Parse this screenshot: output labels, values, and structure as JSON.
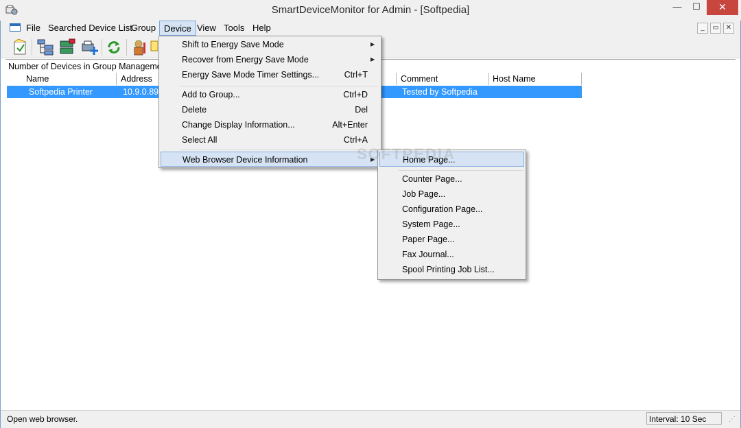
{
  "window": {
    "title": "SmartDeviceMonitor for Admin - [Softpedia]"
  },
  "title_buttons": {
    "minimize": "—",
    "maximize": "☐",
    "close": "✕"
  },
  "menubar": {
    "items": [
      "File",
      "Searched Device List",
      "Group",
      "Device",
      "View",
      "Tools",
      "Help"
    ],
    "mdi_buttons": [
      "_",
      "▭",
      "✕"
    ]
  },
  "group_bar": {
    "label": "Number of Devices in Group Managemer"
  },
  "list": {
    "columns": [
      "Name",
      "Address",
      "Comment",
      "Host Name"
    ],
    "rows": [
      {
        "name": "Softpedia Printer",
        "address": "10.9.0.89",
        "comment": "Tested by Softpedia",
        "host_name": ""
      }
    ]
  },
  "device_menu": {
    "items": [
      {
        "label": "Shift to Energy Save Mode",
        "shortcut": "",
        "submenu": true
      },
      {
        "label": "Recover from Energy Save Mode",
        "shortcut": "",
        "submenu": true
      },
      {
        "label": "Energy Save Mode Timer Settings...",
        "shortcut": "Ctrl+T",
        "submenu": false
      },
      {
        "label": "Add to Group...",
        "shortcut": "Ctrl+D",
        "submenu": false
      },
      {
        "label": "Delete",
        "shortcut": "Del",
        "submenu": false
      },
      {
        "label": "Change Display Information...",
        "shortcut": "Alt+Enter",
        "submenu": false
      },
      {
        "label": "Select All",
        "shortcut": "Ctrl+A",
        "submenu": false
      },
      {
        "label": "Web Browser Device Information",
        "shortcut": "",
        "submenu": true,
        "highlighted": true
      }
    ]
  },
  "web_submenu": {
    "items": [
      {
        "label": "Home Page...",
        "highlighted": true
      },
      {
        "label": "Counter Page..."
      },
      {
        "label": "Job Page..."
      },
      {
        "label": "Configuration Page..."
      },
      {
        "label": "System Page..."
      },
      {
        "label": "Paper Page..."
      },
      {
        "label": "Fax Journal..."
      },
      {
        "label": "Spool Printing Job List..."
      }
    ]
  },
  "statusbar": {
    "text": "Open web browser.",
    "interval": "Interval: 10 Sec"
  },
  "watermark": "SOFTPEDIA",
  "colors": {
    "selection": "#3399ff",
    "close_button": "#c7463d",
    "menu_highlight": "#d5e3f4"
  }
}
